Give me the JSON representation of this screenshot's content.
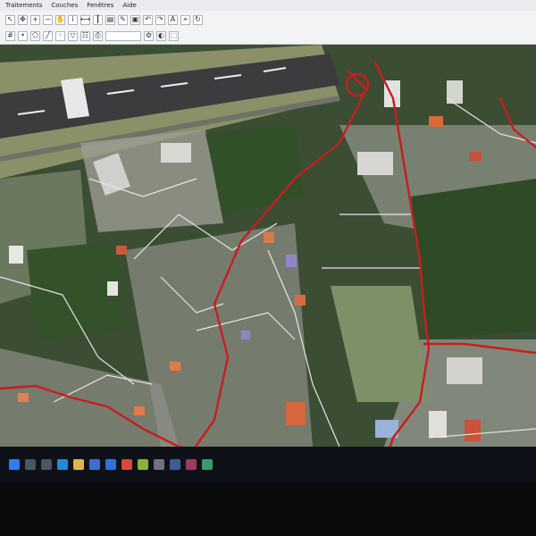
{
  "menubar": {
    "items": [
      "Traitements",
      "Couches",
      "Fenêtres",
      "Aide"
    ]
  },
  "toolbar": {
    "icons": [
      "select-icon",
      "move-icon",
      "zoom-in-icon",
      "zoom-out-icon",
      "pan-icon",
      "identify-icon",
      "measure-icon",
      "ruler-icon",
      "layer-icon",
      "edit-icon",
      "save-icon",
      "undo-icon",
      "redo-icon",
      "label-icon",
      "snap-icon",
      "refresh-icon"
    ],
    "layer_dropdown": ""
  },
  "map": {
    "road_color": "#c81e1e",
    "path_color": "#e6e6e6",
    "runway_color": "#3c3e3f",
    "vegetation_color": "#355a2a",
    "field_color": "#7e9067"
  },
  "taskbar": {
    "icons": [
      "windows-icon",
      "search-icon",
      "task-view-icon",
      "edge-icon",
      "explorer-icon",
      "store-icon",
      "mail-icon",
      "chrome-icon",
      "qgis-icon",
      "settings-icon",
      "app-icon",
      "app-icon-2",
      "app-icon-3"
    ]
  }
}
